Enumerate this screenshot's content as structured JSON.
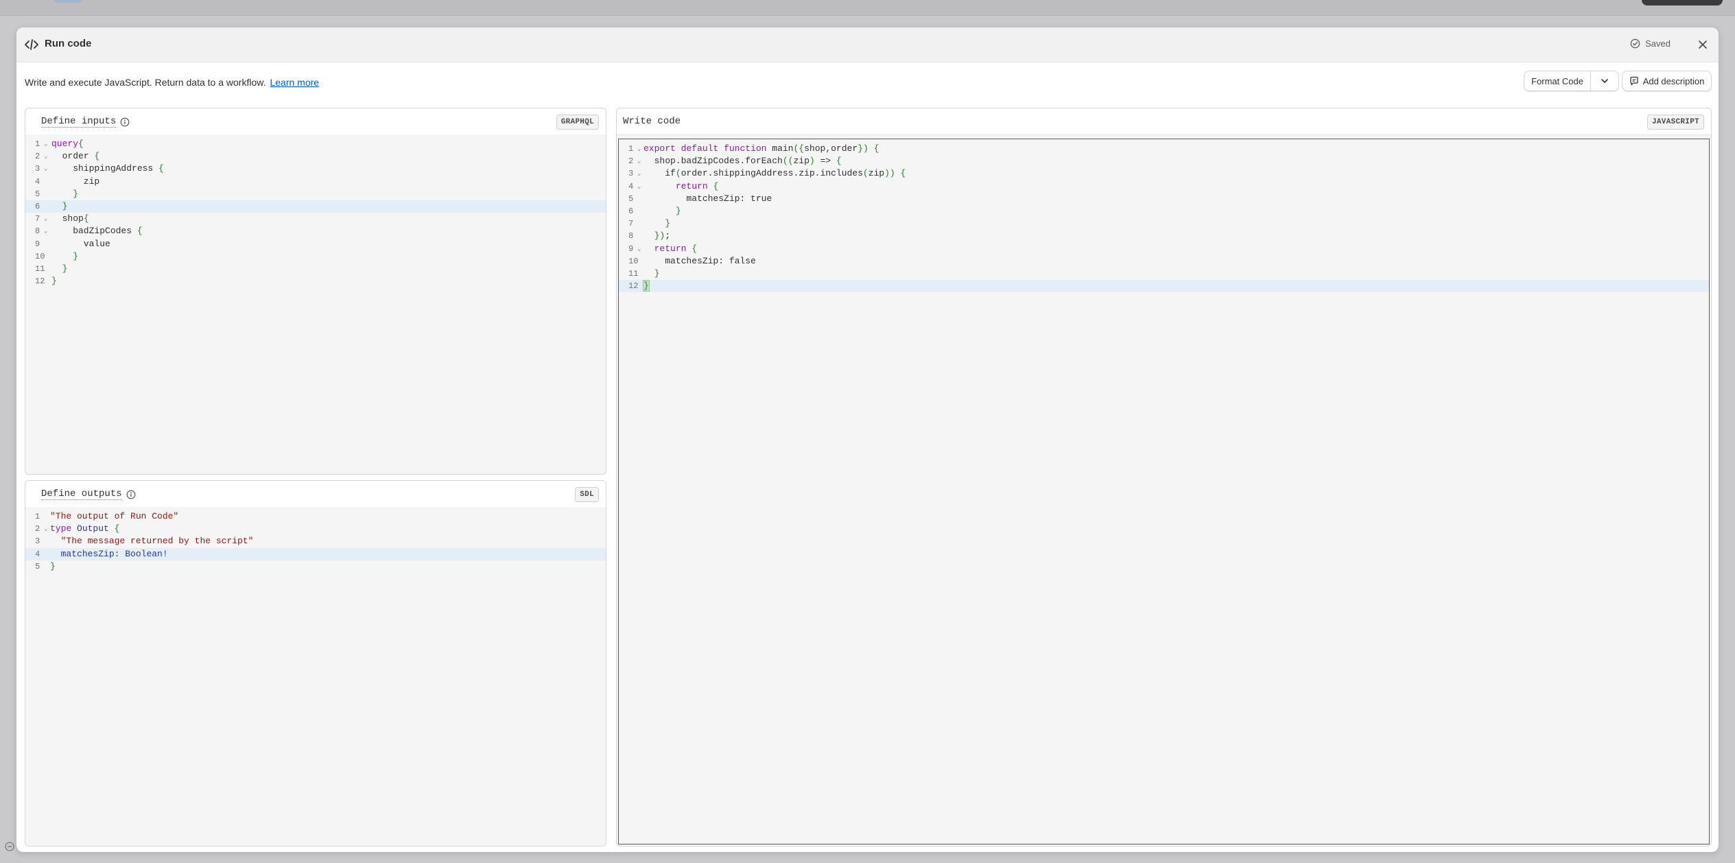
{
  "modal": {
    "title": "Run code",
    "saved_label": "Saved",
    "description": "Write and execute JavaScript. Return data to a workflow.",
    "learn_more": "Learn more",
    "format_code": "Format Code",
    "add_description": "Add description"
  },
  "inputs_panel": {
    "title": "Define inputs",
    "badge": "GRAPHQL",
    "lines": [
      {
        "n": "1",
        "fold": true,
        "text": "query{"
      },
      {
        "n": "2",
        "fold": true,
        "text": "  order {"
      },
      {
        "n": "3",
        "fold": true,
        "text": "    shippingAddress {"
      },
      {
        "n": "4",
        "fold": false,
        "text": "      zip"
      },
      {
        "n": "5",
        "fold": false,
        "text": "    }"
      },
      {
        "n": "6",
        "fold": false,
        "text": "  }"
      },
      {
        "n": "7",
        "fold": true,
        "text": "  shop{"
      },
      {
        "n": "8",
        "fold": true,
        "text": "    badZipCodes {"
      },
      {
        "n": "9",
        "fold": false,
        "text": "      value"
      },
      {
        "n": "10",
        "fold": false,
        "text": "    }"
      },
      {
        "n": "11",
        "fold": false,
        "text": "  }"
      },
      {
        "n": "12",
        "fold": false,
        "text": "}"
      }
    ]
  },
  "outputs_panel": {
    "title": "Define outputs",
    "badge": "SDL",
    "lines": [
      {
        "n": "1",
        "fold": false,
        "text": "\"The output of Run Code\""
      },
      {
        "n": "2",
        "fold": true,
        "text": "type Output {"
      },
      {
        "n": "3",
        "fold": false,
        "text": "  \"The message returned by the script\""
      },
      {
        "n": "4",
        "fold": false,
        "text": "  matchesZip: Boolean!"
      },
      {
        "n": "5",
        "fold": false,
        "text": "}"
      }
    ]
  },
  "code_panel": {
    "title": "Write code",
    "badge": "JAVASCRIPT",
    "lines": [
      {
        "n": "1",
        "fold": true,
        "text": "export default function main({shop,order}) {"
      },
      {
        "n": "2",
        "fold": true,
        "text": "  shop.badZipCodes.forEach((zip) => {"
      },
      {
        "n": "3",
        "fold": true,
        "text": "    if(order.shippingAddress.zip.includes(zip)) {"
      },
      {
        "n": "4",
        "fold": true,
        "text": "      return {"
      },
      {
        "n": "5",
        "fold": false,
        "text": "        matchesZip: true"
      },
      {
        "n": "6",
        "fold": false,
        "text": "      }"
      },
      {
        "n": "7",
        "fold": false,
        "text": "    }"
      },
      {
        "n": "8",
        "fold": false,
        "text": "  });"
      },
      {
        "n": "9",
        "fold": true,
        "text": "  return {"
      },
      {
        "n": "10",
        "fold": false,
        "text": "    matchesZip: false"
      },
      {
        "n": "11",
        "fold": false,
        "text": "  }"
      },
      {
        "n": "12",
        "fold": false,
        "text": "}"
      }
    ]
  },
  "colors": {
    "link": "#005bd3",
    "keyword": "#8c1aac",
    "bracket": "#2a7d2a",
    "string": "#a31515",
    "type": "#1f3aa3",
    "active_line": "#e3eef9"
  }
}
